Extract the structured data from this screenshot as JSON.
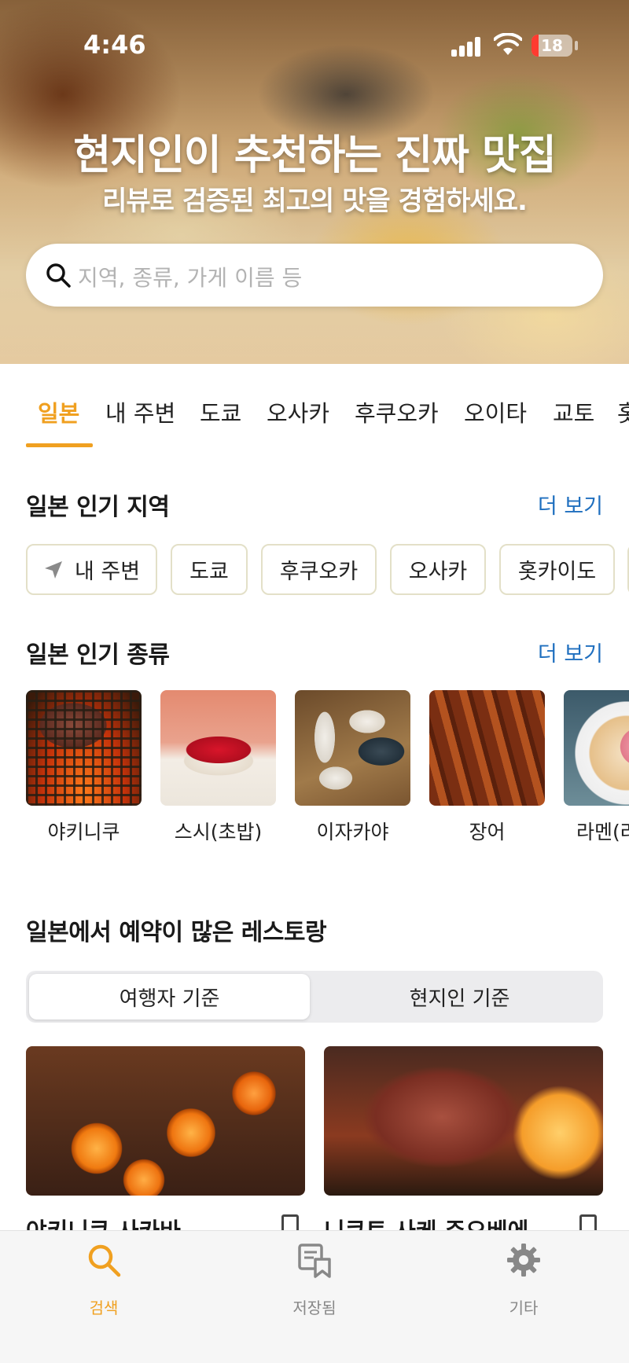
{
  "status_bar": {
    "time": "4:46",
    "battery": "18",
    "battery_level": 0.18
  },
  "hero": {
    "title": "현지인이 추천하는 진짜 맛집",
    "subtitle": "리뷰로 검증된 최고의 맛을 경험하세요.",
    "search_placeholder": "지역, 종류, 가게 이름 등"
  },
  "region_tabs": [
    {
      "label": "일본",
      "active": true
    },
    {
      "label": "내 주변"
    },
    {
      "label": "도쿄"
    },
    {
      "label": "오사카"
    },
    {
      "label": "후쿠오카"
    },
    {
      "label": "오이타"
    },
    {
      "label": "교토"
    },
    {
      "label": "홋"
    }
  ],
  "popular_regions": {
    "title": "일본 인기 지역",
    "more": "더 보기",
    "chips": [
      {
        "label": "내 주변",
        "icon": "location-arrow-icon"
      },
      {
        "label": "도쿄"
      },
      {
        "label": "후쿠오카"
      },
      {
        "label": "오사카"
      },
      {
        "label": "홋카이도"
      }
    ]
  },
  "popular_types": {
    "title": "일본 인기 종류",
    "more": "더 보기",
    "items": [
      {
        "label": "야키니쿠"
      },
      {
        "label": "스시(초밥)"
      },
      {
        "label": "이자카야"
      },
      {
        "label": "장어"
      },
      {
        "label": "라멘(라"
      }
    ]
  },
  "reservations": {
    "title": "일본에서 예약이 많은 레스토랑",
    "segments": [
      "여행자 기준",
      "현지인 기준"
    ],
    "active_segment": 0,
    "restaurants": [
      {
        "name": "야키니쿠 사카바"
      },
      {
        "name": "니쿠토 사케 주오베에"
      }
    ]
  },
  "bottom_nav": [
    {
      "label": "검색",
      "icon": "search-icon",
      "active": true
    },
    {
      "label": "저장됨",
      "icon": "bookmark-list-icon"
    },
    {
      "label": "기타",
      "icon": "gear-icon"
    }
  ],
  "colors": {
    "accent": "#f0a020",
    "link": "#1f6fbf"
  }
}
